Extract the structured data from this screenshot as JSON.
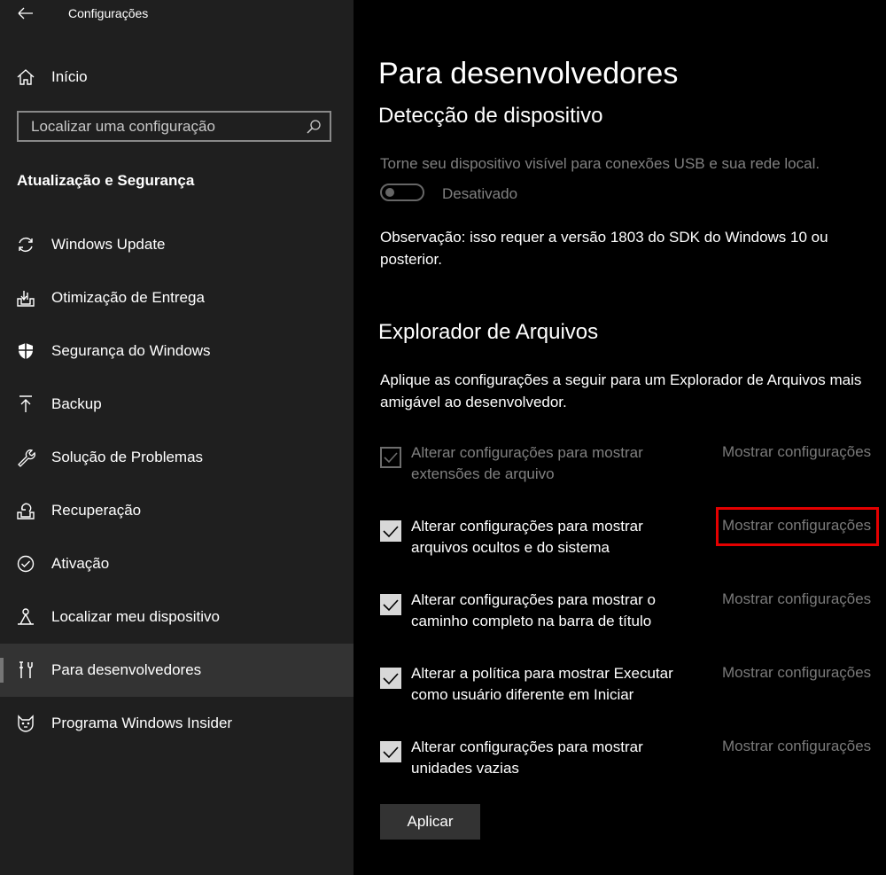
{
  "window": {
    "title": "Configurações"
  },
  "sidebar": {
    "home_label": "Início",
    "search_placeholder": "Localizar uma configuração",
    "section_title": "Atualização e Segurança",
    "items": [
      {
        "label": "Windows Update",
        "icon": "sync-icon"
      },
      {
        "label": "Otimização de Entrega",
        "icon": "delivery-optimization-icon"
      },
      {
        "label": "Segurança do Windows",
        "icon": "shield-icon"
      },
      {
        "label": "Backup",
        "icon": "backup-arrow-icon"
      },
      {
        "label": "Solução de Problemas",
        "icon": "wrench-icon"
      },
      {
        "label": "Recuperação",
        "icon": "recovery-icon"
      },
      {
        "label": "Ativação",
        "icon": "check-circle-icon"
      },
      {
        "label": "Localizar meu dispositivo",
        "icon": "find-device-icon"
      },
      {
        "label": "Para desenvolvedores",
        "icon": "developer-tools-icon",
        "selected": true
      },
      {
        "label": "Programa Windows Insider",
        "icon": "insider-cat-icon"
      }
    ]
  },
  "main": {
    "page_title": "Para desenvolvedores",
    "device_discovery": {
      "heading": "Detecção de dispositivo",
      "description": "Torne seu dispositivo visível para conexões USB e sua rede local.",
      "toggle_label": "Desativado",
      "note_line1": "Observação: isso requer a versão 1803 do SDK do Windows 10 ou",
      "note_line2": "posterior."
    },
    "file_explorer": {
      "heading": "Explorador de Arquivos",
      "description_line1": "Aplique as configurações a seguir para um Explorador de Arquivos mais",
      "description_line2": "amigável ao desenvolvedor.",
      "options": [
        {
          "line1": "Alterar configurações para mostrar",
          "line2": "extensões de arquivo",
          "link": "Mostrar configurações",
          "disabled": true
        },
        {
          "line1": "Alterar configurações para mostrar",
          "line2": "arquivos ocultos e do sistema",
          "link": "Mostrar configurações",
          "disabled": false
        },
        {
          "line1": "Alterar configurações para mostrar o",
          "line2": "caminho completo na barra de título",
          "link": "Mostrar configurações",
          "disabled": false
        },
        {
          "line1": "Alterar a política para mostrar Executar",
          "line2": "como usuário diferente em Iniciar",
          "link": "Mostrar configurações",
          "disabled": false
        },
        {
          "line1": "Alterar configurações para mostrar",
          "line2": "unidades vazias",
          "link": "Mostrar configurações",
          "disabled": false
        }
      ],
      "apply_label": "Aplicar"
    }
  },
  "colors": {
    "sidebar_bg": "#1f1f1f",
    "main_bg": "#000000",
    "highlight": "#e40000"
  }
}
